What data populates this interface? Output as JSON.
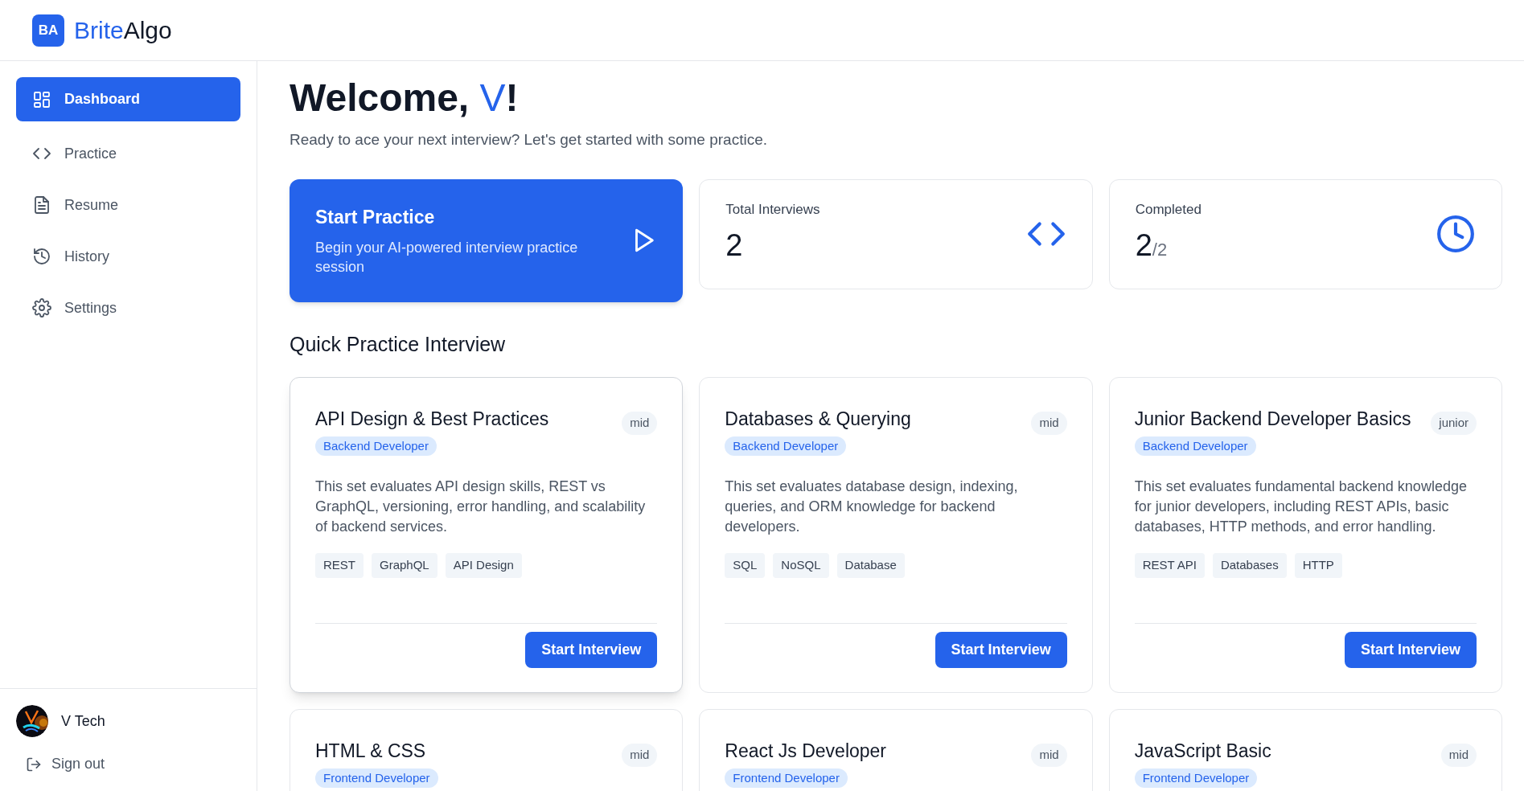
{
  "brand": {
    "mark": "BA",
    "name_first": "Brite",
    "name_second": "Algo"
  },
  "sidebar": {
    "items": [
      {
        "label": "Dashboard",
        "kind": "grid",
        "selected": true
      },
      {
        "label": "Practice",
        "kind": "code",
        "selected": false
      },
      {
        "label": "Resume",
        "kind": "file",
        "selected": false
      },
      {
        "label": "History",
        "kind": "history",
        "selected": false
      },
      {
        "label": "Settings",
        "kind": "gear",
        "selected": false
      }
    ],
    "user": {
      "name": "V Tech"
    },
    "sign_out": "Sign out"
  },
  "welcome": {
    "greeting": "Welcome, ",
    "name": "V",
    "punct": "!",
    "subtitle": "Ready to ace your next interview? Let's get started with some practice."
  },
  "stats": [
    {
      "kind": "action",
      "title": "Start Practice",
      "text": "Begin your AI-powered interview practice session"
    },
    {
      "kind": "stat",
      "title": "Total Interviews",
      "value": "2"
    },
    {
      "kind": "stat",
      "title": "Completed",
      "value": "2",
      "total": "/2"
    }
  ],
  "quick_practice": {
    "heading": "Quick Practice Interview",
    "cards": [
      {
        "title": "API Design & Best Practices",
        "level": "mid",
        "role": "Backend Developer",
        "hovered": true,
        "description": "This set evaluates API design skills, REST vs GraphQL, versioning, error handling, and scalability of backend services.",
        "tags": [
          "REST",
          "GraphQL",
          "API Design"
        ],
        "button": "Start Interview"
      },
      {
        "title": "Databases & Querying",
        "level": "mid",
        "role": "Backend Developer",
        "hovered": false,
        "description": "This set evaluates database design, indexing, queries, and ORM knowledge for backend developers.",
        "tags": [
          "SQL",
          "NoSQL",
          "Database"
        ],
        "button": "Start Interview"
      },
      {
        "title": "Junior Backend Developer Basics",
        "level": "junior",
        "role": "Backend Developer",
        "hovered": false,
        "description": "This set evaluates fundamental backend knowledge for junior developers, including REST APIs, basic databases, HTTP methods, and error handling.",
        "tags": [
          "REST API",
          "Databases",
          "HTTP"
        ],
        "button": "Start Interview"
      },
      {
        "title": "HTML & CSS",
        "level": "mid",
        "role": "Frontend Developer",
        "hovered": false
      },
      {
        "title": "React Js Developer",
        "level": "mid",
        "role": "Frontend Developer",
        "hovered": false
      },
      {
        "title": "JavaScript Basic",
        "level": "mid",
        "role": "Frontend Developer",
        "hovered": false
      }
    ]
  }
}
